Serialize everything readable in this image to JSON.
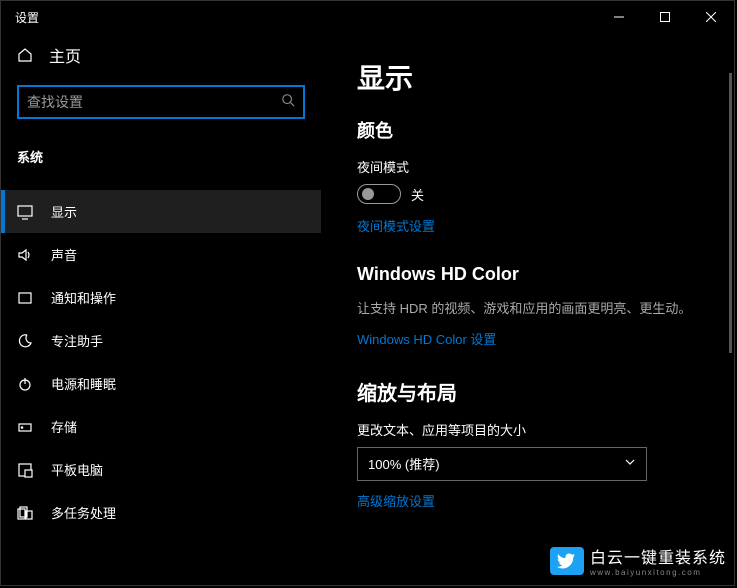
{
  "titlebar": {
    "title": "设置"
  },
  "sidebar": {
    "home": "主页",
    "search_placeholder": "查找设置",
    "section": "系统",
    "items": [
      {
        "label": "显示"
      },
      {
        "label": "声音"
      },
      {
        "label": "通知和操作"
      },
      {
        "label": "专注助手"
      },
      {
        "label": "电源和睡眠"
      },
      {
        "label": "存储"
      },
      {
        "label": "平板电脑"
      },
      {
        "label": "多任务处理"
      }
    ]
  },
  "content": {
    "page_title": "显示",
    "color": {
      "heading": "颜色",
      "night_mode_label": "夜间模式",
      "toggle_state": "关",
      "night_mode_link": "夜间模式设置"
    },
    "hd": {
      "heading": "Windows HD Color",
      "desc": "让支持 HDR 的视频、游戏和应用的画面更明亮、更生动。",
      "link": "Windows HD Color 设置"
    },
    "scale": {
      "heading": "缩放与布局",
      "label": "更改文本、应用等项目的大小",
      "dropdown_value": "100% (推荐)",
      "advanced_link": "高级缩放设置"
    }
  },
  "watermark": {
    "cn": "白云一键重装系统",
    "url": "www.baiyunxitong.com"
  }
}
